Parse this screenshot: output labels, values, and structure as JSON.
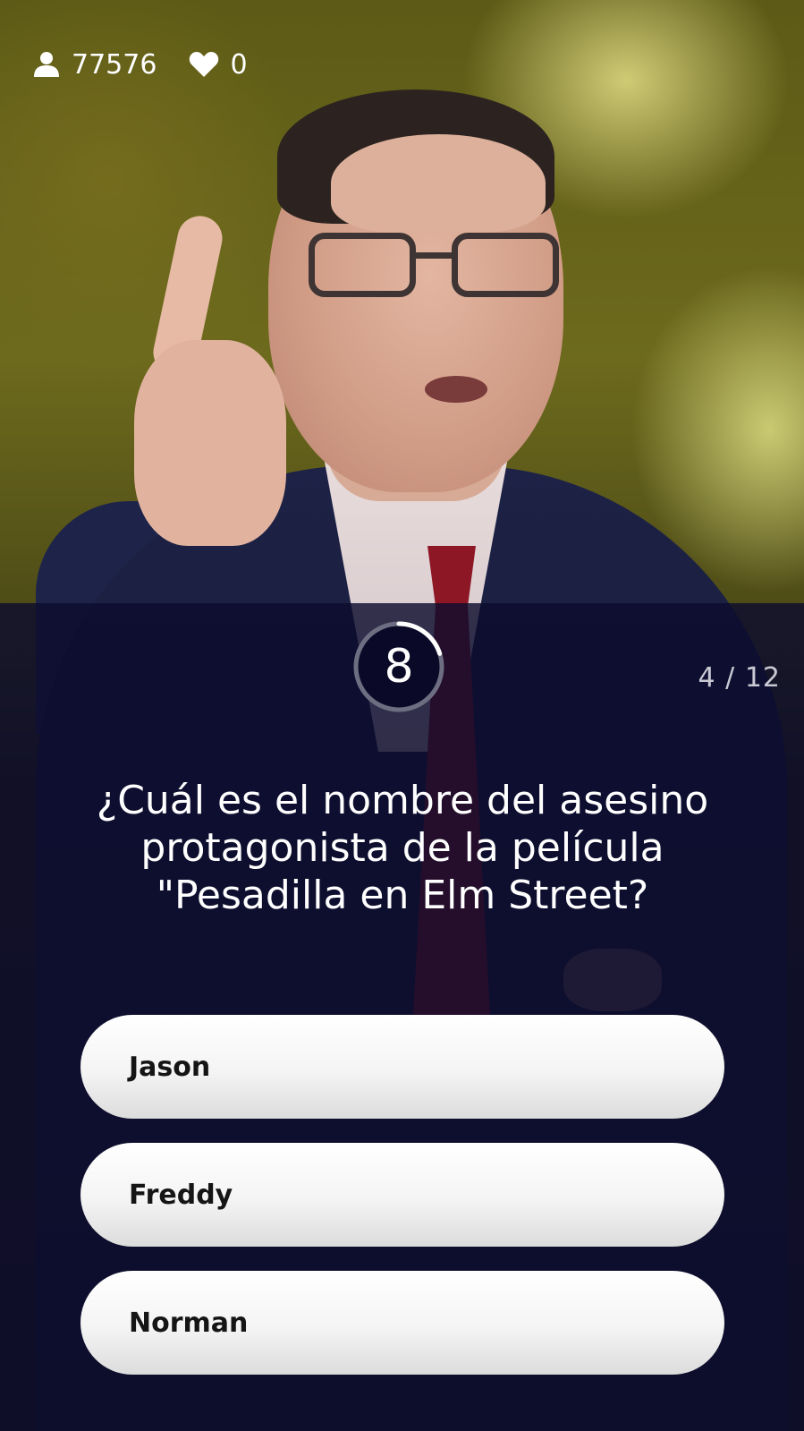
{
  "stats": {
    "viewers_icon": "user-icon",
    "viewers": "77576",
    "lives_icon": "heart-icon",
    "lives": "0"
  },
  "timer": {
    "seconds": "8",
    "elapsed_fraction": 0.2
  },
  "progress": {
    "text": "4 / 12"
  },
  "question": {
    "text": "¿Cuál es el nombre del asesino protagonista de la película \"Pesadilla en Elm Street?"
  },
  "answers": [
    {
      "label": "Jason"
    },
    {
      "label": "Freddy"
    },
    {
      "label": "Norman"
    }
  ],
  "colors": {
    "overlay": "#0c0c2d",
    "answer_bg": "#f4f4f4",
    "answer_text": "#151515",
    "timer_ring": "#6e6e82",
    "timer_ring_active": "#ffffff"
  }
}
